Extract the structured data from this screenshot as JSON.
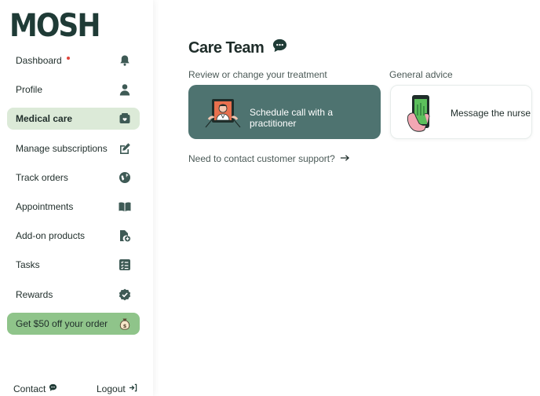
{
  "brand": {
    "logo_text": "MOSH"
  },
  "sidebar": {
    "items": [
      {
        "label": "Dashboard",
        "icon": "bell-icon",
        "notification": true
      },
      {
        "label": "Profile",
        "icon": "user-icon"
      },
      {
        "label": "Medical care",
        "icon": "medical-box-icon",
        "active": true
      },
      {
        "label": "Manage subscriptions",
        "icon": "edit-icon"
      },
      {
        "label": "Track orders",
        "icon": "globe-icon"
      },
      {
        "label": "Appointments",
        "icon": "book-icon"
      },
      {
        "label": "Add-on products",
        "icon": "file-add-icon"
      },
      {
        "label": "Tasks",
        "icon": "checklist-icon"
      },
      {
        "label": "Rewards",
        "icon": "badge-check-icon"
      },
      {
        "label": "Get $50 off your order",
        "icon": "money-bag-icon",
        "promo": true
      }
    ],
    "footer": {
      "contact_label": "Contact",
      "logout_label": "Logout"
    }
  },
  "main": {
    "title": "Care Team",
    "title_icon": "chat-bubble-icon",
    "treatment_label": "Review or change your treatment",
    "advice_label": "General advice",
    "cards": {
      "schedule_label": "Schedule call with a practitioner",
      "nurse_label": "Message the nurse"
    },
    "support_label": "Need to contact customer support?"
  },
  "colors": {
    "brand_dark": "#1f3b36",
    "active_bg": "#dcead8",
    "promo_bg": "#8fc48a",
    "card_dark_bg": "#4e7370",
    "notification_dot": "#e0463c"
  }
}
